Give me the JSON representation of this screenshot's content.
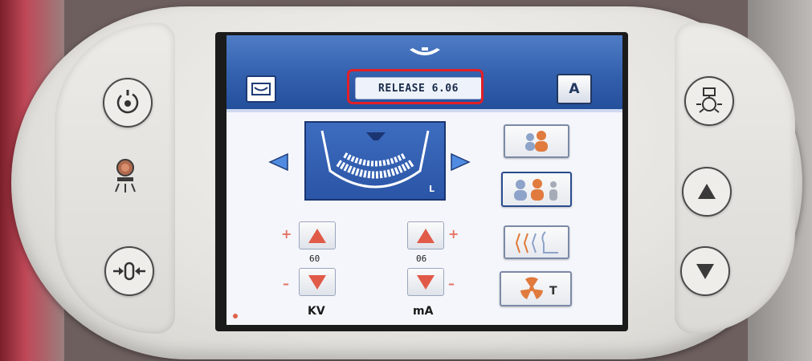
{
  "header": {
    "release_label": "RELEASE 6.06",
    "mode_button_label": "A"
  },
  "exposure": {
    "kv": {
      "value": "60",
      "unit_label": "KV",
      "plus_label": "+",
      "minus_label": "–"
    },
    "ma": {
      "value": "06",
      "unit_label": "mA",
      "plus_label": "+",
      "minus_label": "–"
    }
  },
  "program": {
    "selected_view_label": "L"
  },
  "icons": {
    "top_indicator": "arch-indicator-icon",
    "film": "panoramic-film-icon",
    "patient_small": "two-patients-icon",
    "patient_large": "three-patients-icon",
    "tmj": "tmj-program-icon",
    "radiation_test": "radiation-test-icon",
    "ready": "ready-indicator-icon",
    "xray_lamp": "xray-lamp-icon",
    "return_position": "return-position-icon",
    "laser": "laser-positioning-icon",
    "up": "up-arrow-icon",
    "down": "down-arrow-icon",
    "radiation_t_label": "T"
  },
  "colors": {
    "header_blue": "#3360ad",
    "highlight_red": "#e21f26",
    "adult_orange": "#e07a3d",
    "child_blue": "#8ea3c9"
  }
}
